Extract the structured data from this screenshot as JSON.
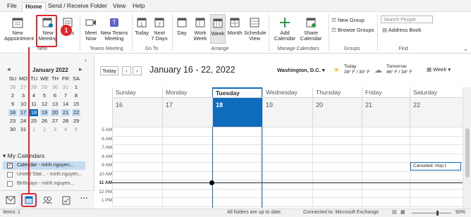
{
  "menu": {
    "tabs": [
      "File",
      "Home",
      "Send / Receive",
      "Folder",
      "View",
      "Help"
    ],
    "active": "Home"
  },
  "ribbon": {
    "new_appointment": "New\nAppointment",
    "new_meeting": "New\nMeeting",
    "items": "Items",
    "group_new": "New",
    "meet_now": "Meet\nNow",
    "new_teams_meeting": "New Teams\nMeeting",
    "group_teams": "Teams Meeting",
    "today": "Today",
    "next7": "Next\n7 Days",
    "group_goto": "Go To",
    "day": "Day",
    "work_week": "Work\nWeek",
    "week": "Week",
    "month": "Month",
    "schedule_view": "Schedule\nView",
    "group_arrange": "Arrange",
    "add_calendar": "Add\nCalendar",
    "share_calendar": "Share\nCalendar",
    "group_manage": "Manage Calendars",
    "new_group": "New Group",
    "browse_groups": "Browse Groups",
    "group_groups": "Groups",
    "search_people_placeholder": "Search People",
    "address_book": "Address Book",
    "group_find": "Find"
  },
  "annotation": {
    "step": "1"
  },
  "mini_calendar": {
    "title": "January 2022",
    "dow": [
      "SU",
      "MO",
      "TU",
      "WE",
      "TH",
      "FR",
      "SA"
    ],
    "weeks": [
      [
        "26",
        "27",
        "28",
        "29",
        "30",
        "31",
        "1"
      ],
      [
        "2",
        "3",
        "4",
        "5",
        "6",
        "7",
        "8"
      ],
      [
        "9",
        "10",
        "11",
        "12",
        "13",
        "14",
        "15"
      ],
      [
        "16",
        "17",
        "18",
        "19",
        "20",
        "21",
        "22"
      ],
      [
        "23",
        "24",
        "25",
        "26",
        "27",
        "28",
        "29"
      ],
      [
        "30",
        "31",
        "1",
        "2",
        "3",
        "4",
        "5"
      ]
    ]
  },
  "folders": {
    "heading": "My Calendars",
    "items": [
      "Calendar - minh.nguyen...",
      "United Stat... - minh.nguyen...",
      "Birthdays - minh.nguyen..."
    ]
  },
  "calendar": {
    "today_btn": "Today",
    "range_title": "January 16 - 22, 2022",
    "location": "Washington, D.C.",
    "weather_today_label": "Today",
    "weather_today_temp": "39° F / 30° F",
    "weather_tomorrow_label": "Tomorrow",
    "weather_tomorrow_temp": "46° F / 34° F",
    "view_select": "Week",
    "days": [
      "Sunday",
      "Monday",
      "Tuesday",
      "Wednesday",
      "Thursday",
      "Friday",
      "Saturday"
    ],
    "dates": [
      "16",
      "17",
      "18",
      "19",
      "20",
      "21",
      "22"
    ],
    "times": [
      "5 AM",
      "6 AM",
      "7 AM",
      "8 AM",
      "9 AM",
      "10 AM",
      "11 AM",
      "12 PM",
      "1 PM"
    ],
    "event": "Canceled: Hop t"
  },
  "status": {
    "items": "Items: 1",
    "sync": "All folders are up to date.",
    "connection": "Connected to: Microsoft Exchange",
    "zoom": "90%"
  },
  "colors": {
    "accent": "#0f6cbd",
    "annotation": "#e0262c",
    "today_column": "#0f6cbd"
  }
}
